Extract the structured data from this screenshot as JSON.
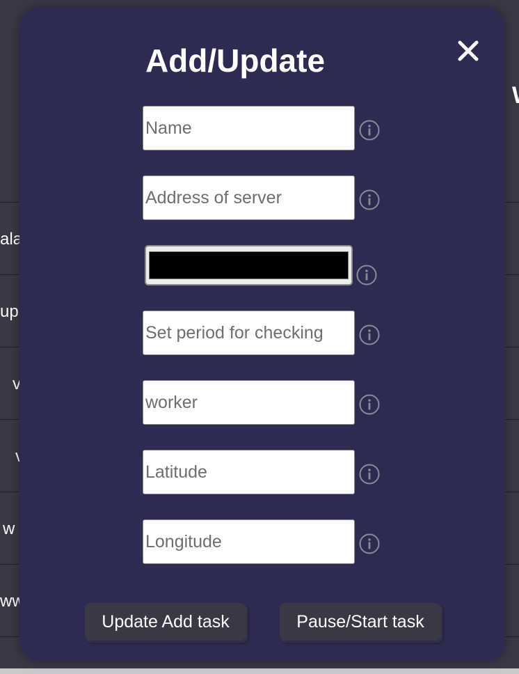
{
  "background": {
    "heading_fragment": "W",
    "row_fragments": [
      "ala",
      "up",
      "v",
      "v",
      "w",
      "ww"
    ]
  },
  "modal": {
    "title": "Add/Update",
    "close_icon": "close-icon",
    "fields": {
      "name_placeholder": "Name",
      "address_placeholder": "Address of server",
      "color_value": "#000000",
      "period_placeholder": "Set period for checking",
      "worker_value": "worker",
      "latitude_placeholder": "Latitude",
      "longitude_placeholder": "Longitude"
    },
    "info_icon": "info-icon",
    "buttons": {
      "update_add": "Update Add task",
      "pause_start": "Pause/Start task"
    }
  },
  "colors": {
    "modal_background": "#2e2b52",
    "page_background": "#393946",
    "button_background": "#3a3845"
  }
}
